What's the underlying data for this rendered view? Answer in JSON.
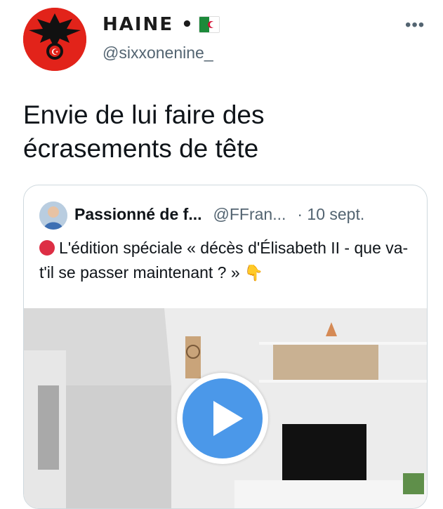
{
  "tweet": {
    "display_name": "HAINE •",
    "handle": "@sixxonenine_",
    "more_label": "•••",
    "text": "Envie de lui faire des écrasements de tête",
    "flag_icon": "algeria-flag-icon"
  },
  "quoted_tweet": {
    "name": "Passionné de f...",
    "handle": "@FFran...",
    "date": "· 10 sept.",
    "text": "L'édition spéciale « décès d'Élisabeth II - que va-t'il se passer maintenant ? »",
    "media_type": "video",
    "play_icon": "play-icon",
    "accent_color": "#4b98e9"
  }
}
